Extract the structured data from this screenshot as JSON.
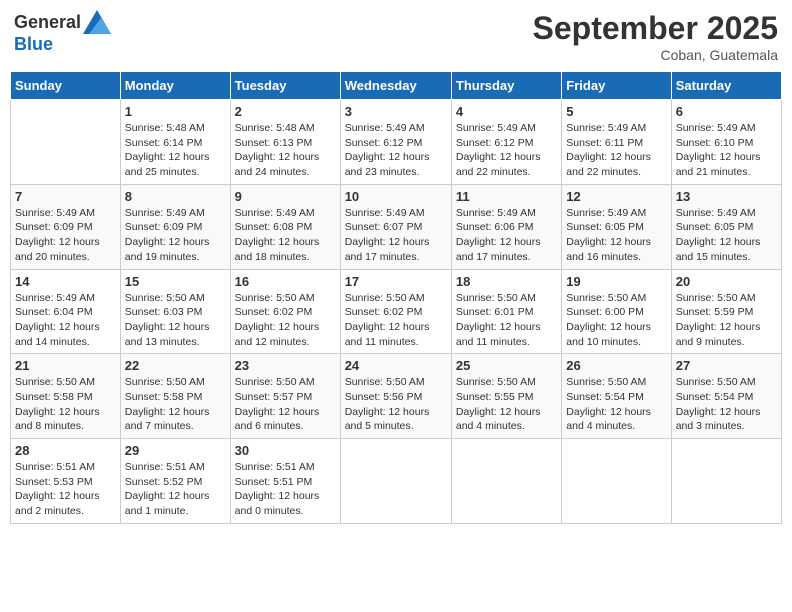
{
  "header": {
    "logo_general": "General",
    "logo_blue": "Blue",
    "month_title": "September 2025",
    "location": "Coban, Guatemala"
  },
  "weekdays": [
    "Sunday",
    "Monday",
    "Tuesday",
    "Wednesday",
    "Thursday",
    "Friday",
    "Saturday"
  ],
  "weeks": [
    [
      {
        "day": "",
        "info": ""
      },
      {
        "day": "1",
        "info": "Sunrise: 5:48 AM\nSunset: 6:14 PM\nDaylight: 12 hours\nand 25 minutes."
      },
      {
        "day": "2",
        "info": "Sunrise: 5:48 AM\nSunset: 6:13 PM\nDaylight: 12 hours\nand 24 minutes."
      },
      {
        "day": "3",
        "info": "Sunrise: 5:49 AM\nSunset: 6:12 PM\nDaylight: 12 hours\nand 23 minutes."
      },
      {
        "day": "4",
        "info": "Sunrise: 5:49 AM\nSunset: 6:12 PM\nDaylight: 12 hours\nand 22 minutes."
      },
      {
        "day": "5",
        "info": "Sunrise: 5:49 AM\nSunset: 6:11 PM\nDaylight: 12 hours\nand 22 minutes."
      },
      {
        "day": "6",
        "info": "Sunrise: 5:49 AM\nSunset: 6:10 PM\nDaylight: 12 hours\nand 21 minutes."
      }
    ],
    [
      {
        "day": "7",
        "info": "Sunrise: 5:49 AM\nSunset: 6:09 PM\nDaylight: 12 hours\nand 20 minutes."
      },
      {
        "day": "8",
        "info": "Sunrise: 5:49 AM\nSunset: 6:09 PM\nDaylight: 12 hours\nand 19 minutes."
      },
      {
        "day": "9",
        "info": "Sunrise: 5:49 AM\nSunset: 6:08 PM\nDaylight: 12 hours\nand 18 minutes."
      },
      {
        "day": "10",
        "info": "Sunrise: 5:49 AM\nSunset: 6:07 PM\nDaylight: 12 hours\nand 17 minutes."
      },
      {
        "day": "11",
        "info": "Sunrise: 5:49 AM\nSunset: 6:06 PM\nDaylight: 12 hours\nand 17 minutes."
      },
      {
        "day": "12",
        "info": "Sunrise: 5:49 AM\nSunset: 6:05 PM\nDaylight: 12 hours\nand 16 minutes."
      },
      {
        "day": "13",
        "info": "Sunrise: 5:49 AM\nSunset: 6:05 PM\nDaylight: 12 hours\nand 15 minutes."
      }
    ],
    [
      {
        "day": "14",
        "info": "Sunrise: 5:49 AM\nSunset: 6:04 PM\nDaylight: 12 hours\nand 14 minutes."
      },
      {
        "day": "15",
        "info": "Sunrise: 5:50 AM\nSunset: 6:03 PM\nDaylight: 12 hours\nand 13 minutes."
      },
      {
        "day": "16",
        "info": "Sunrise: 5:50 AM\nSunset: 6:02 PM\nDaylight: 12 hours\nand 12 minutes."
      },
      {
        "day": "17",
        "info": "Sunrise: 5:50 AM\nSunset: 6:02 PM\nDaylight: 12 hours\nand 11 minutes."
      },
      {
        "day": "18",
        "info": "Sunrise: 5:50 AM\nSunset: 6:01 PM\nDaylight: 12 hours\nand 11 minutes."
      },
      {
        "day": "19",
        "info": "Sunrise: 5:50 AM\nSunset: 6:00 PM\nDaylight: 12 hours\nand 10 minutes."
      },
      {
        "day": "20",
        "info": "Sunrise: 5:50 AM\nSunset: 5:59 PM\nDaylight: 12 hours\nand 9 minutes."
      }
    ],
    [
      {
        "day": "21",
        "info": "Sunrise: 5:50 AM\nSunset: 5:58 PM\nDaylight: 12 hours\nand 8 minutes."
      },
      {
        "day": "22",
        "info": "Sunrise: 5:50 AM\nSunset: 5:58 PM\nDaylight: 12 hours\nand 7 minutes."
      },
      {
        "day": "23",
        "info": "Sunrise: 5:50 AM\nSunset: 5:57 PM\nDaylight: 12 hours\nand 6 minutes."
      },
      {
        "day": "24",
        "info": "Sunrise: 5:50 AM\nSunset: 5:56 PM\nDaylight: 12 hours\nand 5 minutes."
      },
      {
        "day": "25",
        "info": "Sunrise: 5:50 AM\nSunset: 5:55 PM\nDaylight: 12 hours\nand 4 minutes."
      },
      {
        "day": "26",
        "info": "Sunrise: 5:50 AM\nSunset: 5:54 PM\nDaylight: 12 hours\nand 4 minutes."
      },
      {
        "day": "27",
        "info": "Sunrise: 5:50 AM\nSunset: 5:54 PM\nDaylight: 12 hours\nand 3 minutes."
      }
    ],
    [
      {
        "day": "28",
        "info": "Sunrise: 5:51 AM\nSunset: 5:53 PM\nDaylight: 12 hours\nand 2 minutes."
      },
      {
        "day": "29",
        "info": "Sunrise: 5:51 AM\nSunset: 5:52 PM\nDaylight: 12 hours\nand 1 minute."
      },
      {
        "day": "30",
        "info": "Sunrise: 5:51 AM\nSunset: 5:51 PM\nDaylight: 12 hours\nand 0 minutes."
      },
      {
        "day": "",
        "info": ""
      },
      {
        "day": "",
        "info": ""
      },
      {
        "day": "",
        "info": ""
      },
      {
        "day": "",
        "info": ""
      }
    ]
  ]
}
